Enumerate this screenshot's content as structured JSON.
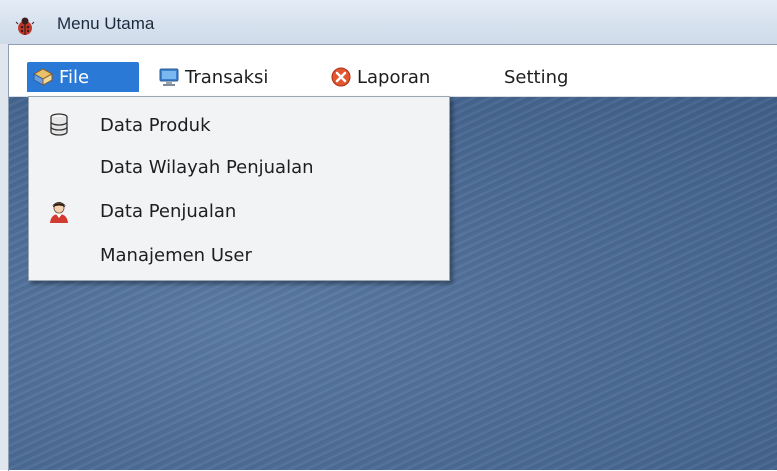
{
  "window": {
    "title": "Menu Utama",
    "icon": "ladybug-icon"
  },
  "menubar": {
    "items": [
      {
        "label": "File",
        "icon": "book-icon",
        "active": true
      },
      {
        "label": "Transaksi",
        "icon": "monitor-icon"
      },
      {
        "label": "Laporan",
        "icon": "close-circle-icon"
      },
      {
        "label": "Setting"
      }
    ]
  },
  "file_menu": {
    "items": [
      {
        "label": "Data Produk",
        "icon": "database-icon"
      },
      {
        "label": "Data Wilayah Penjualan"
      },
      {
        "label": "Data Penjualan",
        "icon": "user-icon"
      },
      {
        "label": "Manajemen User"
      }
    ]
  },
  "colors": {
    "menu_highlight": "#2b79d6",
    "desktop": "#4b6b95"
  }
}
